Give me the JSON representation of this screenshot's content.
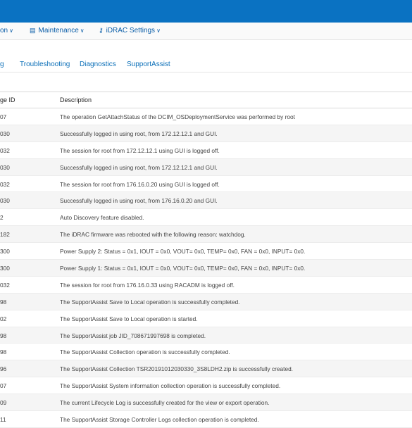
{
  "menu": {
    "item1": "on",
    "maintenance": "Maintenance",
    "idrac_settings": "iDRAC Settings"
  },
  "subtabs": [
    "g",
    "Troubleshooting",
    "Diagnostics",
    "SupportAssist"
  ],
  "table": {
    "headers": [
      "ge ID",
      "Description"
    ],
    "rows": [
      {
        "id": "07",
        "desc": "The operation GetAttachStatus of the DCIM_OSDeploymentService was performed by root"
      },
      {
        "id": "030",
        "desc": "Successfully logged in using root, from 172.12.12.1 and GUI."
      },
      {
        "id": "032",
        "desc": "The session for root from 172.12.12.1 using GUI is logged off."
      },
      {
        "id": "030",
        "desc": "Successfully logged in using root, from 172.12.12.1 and GUI."
      },
      {
        "id": "032",
        "desc": "The session for root from 176.16.0.20 using GUI is logged off."
      },
      {
        "id": "030",
        "desc": "Successfully logged in using root, from 176.16.0.20 and GUI."
      },
      {
        "id": "2",
        "desc": "Auto Discovery feature disabled."
      },
      {
        "id": "182",
        "desc": "The iDRAC firmware was rebooted with the following reason: watchdog."
      },
      {
        "id": "300",
        "desc": "Power Supply 2: Status = 0x1, IOUT = 0x0, VOUT= 0x0, TEMP= 0x0, FAN = 0x0, INPUT= 0x0."
      },
      {
        "id": "300",
        "desc": "Power Supply 1: Status = 0x1, IOUT = 0x0, VOUT= 0x0, TEMP= 0x0, FAN = 0x0, INPUT= 0x0."
      },
      {
        "id": "032",
        "desc": "The session for root from 176.16.0.33 using RACADM is logged off."
      },
      {
        "id": "98",
        "desc": "The SupportAssist Save to Local operation is successfully completed."
      },
      {
        "id": "02",
        "desc": "The SupportAssist Save to Local operation is started."
      },
      {
        "id": "98",
        "desc": "The SupportAssist job JID_708671997698 is completed."
      },
      {
        "id": "98",
        "desc": "The SupportAssist Collection operation is successfully completed."
      },
      {
        "id": "96",
        "desc": "The SupportAssist Collection TSR20191012030330_3S8LDH2.zip is successfully created."
      },
      {
        "id": "07",
        "desc": "The SupportAssist System information collection operation is successfully completed."
      },
      {
        "id": "09",
        "desc": "The current Lifecycle Log is successfully created for the view or export operation."
      },
      {
        "id": "11",
        "desc": "The SupportAssist Storage Controller Logs collection operation is completed."
      }
    ]
  },
  "colors": {
    "header_blue": "#0a72c2",
    "link_blue": "#0b6fb8"
  }
}
